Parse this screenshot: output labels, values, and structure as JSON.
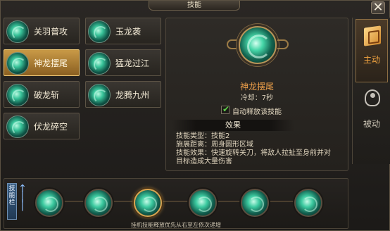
{
  "window": {
    "title": "技能",
    "close_label": "✕"
  },
  "skills": [
    {
      "name": "关羽普攻",
      "selected": false
    },
    {
      "name": "玉龙袭",
      "selected": false
    },
    {
      "name": "神龙摆尾",
      "selected": true
    },
    {
      "name": "猛龙过江",
      "selected": false
    },
    {
      "name": "破龙斩",
      "selected": false
    },
    {
      "name": "龙腾九州",
      "selected": false
    },
    {
      "name": "伏龙碎空",
      "selected": false
    }
  ],
  "detail": {
    "name": "神龙摆尾",
    "cooldown": "冷却：7秒",
    "auto_release_label": "自动释放该技能",
    "auto_release_checked": true,
    "effect_header": "效果",
    "lines": [
      "技能类型：技能2",
      "施展距离：周身圆形区域",
      "技能效果：快速旋转关刀，将敌人拉扯至身前并对",
      "目标造成大量伤害"
    ]
  },
  "tabs": [
    {
      "label": "主动",
      "active": true,
      "icon": "book-icon"
    },
    {
      "label": "被动",
      "active": false,
      "icon": "meditation-icon"
    }
  ],
  "skill_bar": {
    "tab_label": "技能栏",
    "hint": "挂机技能释放优先从右至左依次递增",
    "slot_count": 6,
    "highlighted_slot": 3
  },
  "colors": {
    "accent_orange": "#f0a14a",
    "gold": "#c99a47",
    "check_green": "#5fd24a"
  }
}
